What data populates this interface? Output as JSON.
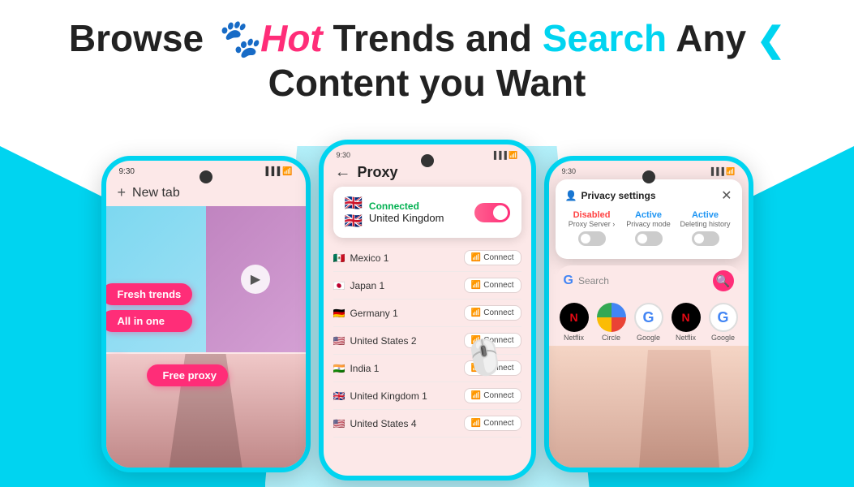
{
  "header": {
    "line1_start": "Browse ",
    "line1_hot": "Hot",
    "line1_middle": " Trends and ",
    "line1_search": "Search",
    "line1_end": " Any",
    "line2": "Content you Want"
  },
  "phone_left": {
    "status_time": "9:30",
    "new_tab_label": "New tab",
    "feature_buttons": [
      "Fresh trends",
      "All in one",
      "Free proxy"
    ],
    "feature_1": "Fresh trends",
    "feature_2": "All in one",
    "feature_3": "Free proxy"
  },
  "phone_mid": {
    "status_time": "9:30",
    "proxy_title": "Proxy",
    "connected_label": "Connected",
    "country_label": "United Kingdom",
    "servers": [
      {
        "flag": "🇲🇽",
        "name": "Mexico 1"
      },
      {
        "flag": "🇯🇵",
        "name": "Japan 1"
      },
      {
        "flag": "🇩🇪",
        "name": "Germany 1"
      },
      {
        "flag": "🇺🇸",
        "name": "United States 2"
      },
      {
        "flag": "🇮🇳",
        "name": "India 1"
      },
      {
        "flag": "🇬🇧",
        "name": "United Kingdom 1"
      },
      {
        "flag": "🇺🇸",
        "name": "United States 4"
      }
    ],
    "connect_btn_label": "Connect"
  },
  "phone_right": {
    "status_time": "9:30",
    "privacy_title": "Privacy settings",
    "col1": {
      "status": "Disabled",
      "label": "Proxy Server ›",
      "toggle_state": "off"
    },
    "col2": {
      "status": "Active",
      "label": "Privacy mode",
      "toggle_state": "off"
    },
    "col3": {
      "status": "Active",
      "label": "Deleting history",
      "toggle_state": "off"
    },
    "search_placeholder": "Search",
    "apps": [
      {
        "name": "Netflix",
        "type": "netflix"
      },
      {
        "name": "Circle",
        "type": "circle"
      },
      {
        "name": "Google",
        "type": "google"
      },
      {
        "name": "Netflix",
        "type": "netflix"
      },
      {
        "name": "Google",
        "type": "google"
      }
    ]
  }
}
